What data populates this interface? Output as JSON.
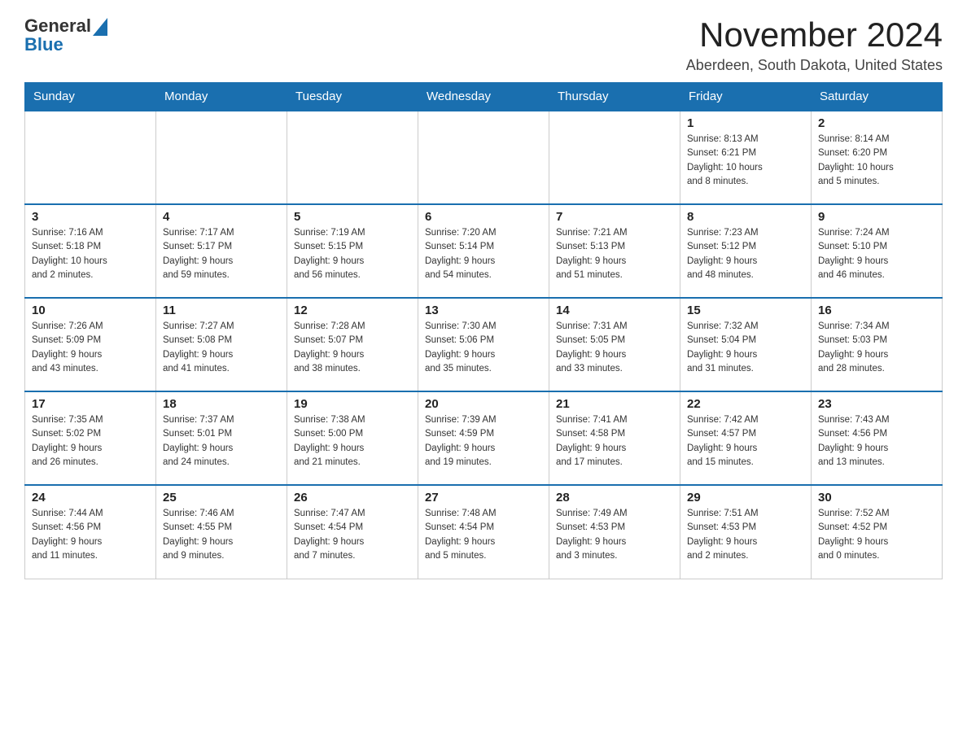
{
  "header": {
    "logo_general": "General",
    "logo_blue": "Blue",
    "month_title": "November 2024",
    "location": "Aberdeen, South Dakota, United States"
  },
  "calendar": {
    "days_of_week": [
      "Sunday",
      "Monday",
      "Tuesday",
      "Wednesday",
      "Thursday",
      "Friday",
      "Saturday"
    ],
    "weeks": [
      [
        {
          "day": "",
          "info": ""
        },
        {
          "day": "",
          "info": ""
        },
        {
          "day": "",
          "info": ""
        },
        {
          "day": "",
          "info": ""
        },
        {
          "day": "",
          "info": ""
        },
        {
          "day": "1",
          "info": "Sunrise: 8:13 AM\nSunset: 6:21 PM\nDaylight: 10 hours\nand 8 minutes."
        },
        {
          "day": "2",
          "info": "Sunrise: 8:14 AM\nSunset: 6:20 PM\nDaylight: 10 hours\nand 5 minutes."
        }
      ],
      [
        {
          "day": "3",
          "info": "Sunrise: 7:16 AM\nSunset: 5:18 PM\nDaylight: 10 hours\nand 2 minutes."
        },
        {
          "day": "4",
          "info": "Sunrise: 7:17 AM\nSunset: 5:17 PM\nDaylight: 9 hours\nand 59 minutes."
        },
        {
          "day": "5",
          "info": "Sunrise: 7:19 AM\nSunset: 5:15 PM\nDaylight: 9 hours\nand 56 minutes."
        },
        {
          "day": "6",
          "info": "Sunrise: 7:20 AM\nSunset: 5:14 PM\nDaylight: 9 hours\nand 54 minutes."
        },
        {
          "day": "7",
          "info": "Sunrise: 7:21 AM\nSunset: 5:13 PM\nDaylight: 9 hours\nand 51 minutes."
        },
        {
          "day": "8",
          "info": "Sunrise: 7:23 AM\nSunset: 5:12 PM\nDaylight: 9 hours\nand 48 minutes."
        },
        {
          "day": "9",
          "info": "Sunrise: 7:24 AM\nSunset: 5:10 PM\nDaylight: 9 hours\nand 46 minutes."
        }
      ],
      [
        {
          "day": "10",
          "info": "Sunrise: 7:26 AM\nSunset: 5:09 PM\nDaylight: 9 hours\nand 43 minutes."
        },
        {
          "day": "11",
          "info": "Sunrise: 7:27 AM\nSunset: 5:08 PM\nDaylight: 9 hours\nand 41 minutes."
        },
        {
          "day": "12",
          "info": "Sunrise: 7:28 AM\nSunset: 5:07 PM\nDaylight: 9 hours\nand 38 minutes."
        },
        {
          "day": "13",
          "info": "Sunrise: 7:30 AM\nSunset: 5:06 PM\nDaylight: 9 hours\nand 35 minutes."
        },
        {
          "day": "14",
          "info": "Sunrise: 7:31 AM\nSunset: 5:05 PM\nDaylight: 9 hours\nand 33 minutes."
        },
        {
          "day": "15",
          "info": "Sunrise: 7:32 AM\nSunset: 5:04 PM\nDaylight: 9 hours\nand 31 minutes."
        },
        {
          "day": "16",
          "info": "Sunrise: 7:34 AM\nSunset: 5:03 PM\nDaylight: 9 hours\nand 28 minutes."
        }
      ],
      [
        {
          "day": "17",
          "info": "Sunrise: 7:35 AM\nSunset: 5:02 PM\nDaylight: 9 hours\nand 26 minutes."
        },
        {
          "day": "18",
          "info": "Sunrise: 7:37 AM\nSunset: 5:01 PM\nDaylight: 9 hours\nand 24 minutes."
        },
        {
          "day": "19",
          "info": "Sunrise: 7:38 AM\nSunset: 5:00 PM\nDaylight: 9 hours\nand 21 minutes."
        },
        {
          "day": "20",
          "info": "Sunrise: 7:39 AM\nSunset: 4:59 PM\nDaylight: 9 hours\nand 19 minutes."
        },
        {
          "day": "21",
          "info": "Sunrise: 7:41 AM\nSunset: 4:58 PM\nDaylight: 9 hours\nand 17 minutes."
        },
        {
          "day": "22",
          "info": "Sunrise: 7:42 AM\nSunset: 4:57 PM\nDaylight: 9 hours\nand 15 minutes."
        },
        {
          "day": "23",
          "info": "Sunrise: 7:43 AM\nSunset: 4:56 PM\nDaylight: 9 hours\nand 13 minutes."
        }
      ],
      [
        {
          "day": "24",
          "info": "Sunrise: 7:44 AM\nSunset: 4:56 PM\nDaylight: 9 hours\nand 11 minutes."
        },
        {
          "day": "25",
          "info": "Sunrise: 7:46 AM\nSunset: 4:55 PM\nDaylight: 9 hours\nand 9 minutes."
        },
        {
          "day": "26",
          "info": "Sunrise: 7:47 AM\nSunset: 4:54 PM\nDaylight: 9 hours\nand 7 minutes."
        },
        {
          "day": "27",
          "info": "Sunrise: 7:48 AM\nSunset: 4:54 PM\nDaylight: 9 hours\nand 5 minutes."
        },
        {
          "day": "28",
          "info": "Sunrise: 7:49 AM\nSunset: 4:53 PM\nDaylight: 9 hours\nand 3 minutes."
        },
        {
          "day": "29",
          "info": "Sunrise: 7:51 AM\nSunset: 4:53 PM\nDaylight: 9 hours\nand 2 minutes."
        },
        {
          "day": "30",
          "info": "Sunrise: 7:52 AM\nSunset: 4:52 PM\nDaylight: 9 hours\nand 0 minutes."
        }
      ]
    ]
  }
}
